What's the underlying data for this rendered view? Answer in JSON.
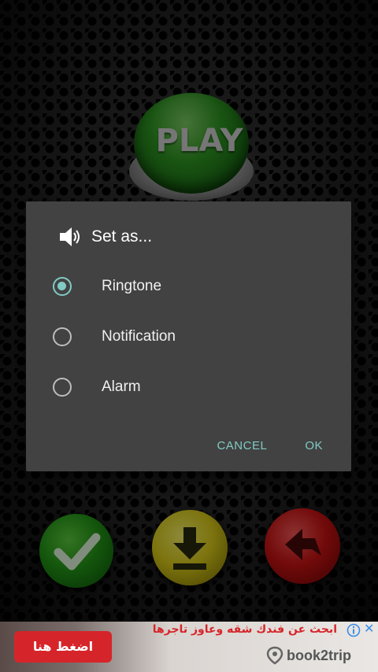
{
  "app": {
    "play_label": "PLAY"
  },
  "dialog": {
    "title": "Set as...",
    "icon": "speaker-icon",
    "options": [
      {
        "label": "Ringtone",
        "selected": true
      },
      {
        "label": "Notification",
        "selected": false
      },
      {
        "label": "Alarm",
        "selected": false
      }
    ],
    "cancel_label": "CANCEL",
    "ok_label": "OK"
  },
  "bottom_buttons": [
    {
      "name": "confirm",
      "icon": "check-icon",
      "color": "#249d17"
    },
    {
      "name": "download",
      "icon": "download-icon",
      "color": "#e3d31b"
    },
    {
      "name": "back",
      "icon": "back-arrow-icon",
      "color": "#d11414"
    }
  ],
  "ad": {
    "cta": "اضغط هنا",
    "headline": "ابحث عن فندك شقه وعاوز تاجرها",
    "brand": "book2trip",
    "close_symbol": "✕"
  },
  "colors": {
    "accent": "#80cbc4",
    "dialog_bg": "#424242"
  }
}
